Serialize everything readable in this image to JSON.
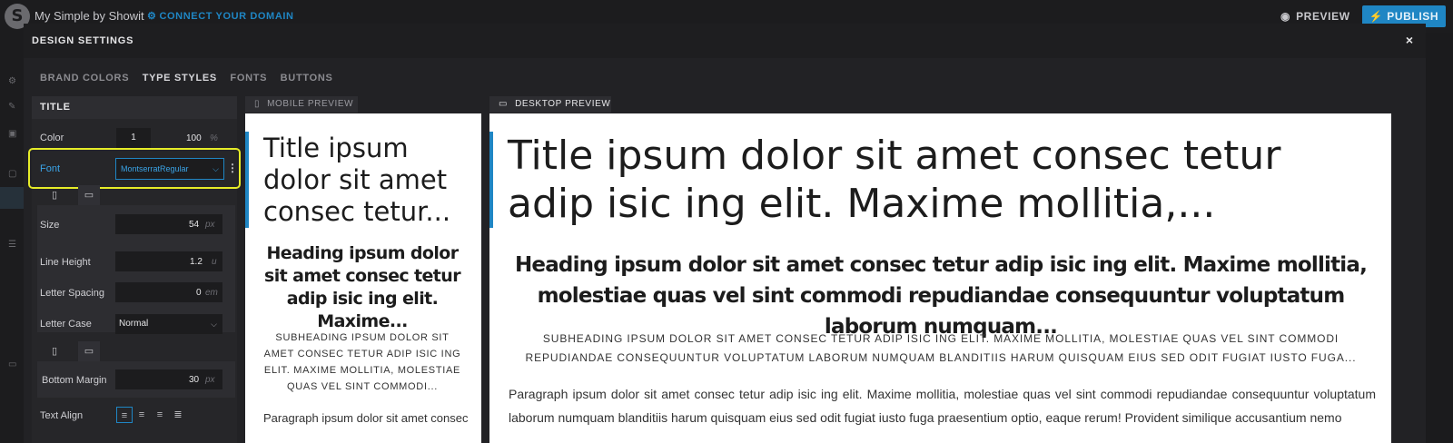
{
  "app": {
    "logo_glyph": "S",
    "site_name": "My Simple by Showit",
    "connect_domain": "CONNECT YOUR DOMAIN",
    "preview_label": "PREVIEW",
    "publish_label": "PUBLISH",
    "accent_color": "#1f86c4",
    "highlight_color": "#e6ec28"
  },
  "modal": {
    "title": "DESIGN SETTINGS",
    "close_glyph": "×",
    "tabs": [
      {
        "label": "BRAND COLORS",
        "active": false
      },
      {
        "label": "TYPE STYLES",
        "active": true
      },
      {
        "label": "FONTS",
        "active": false
      },
      {
        "label": "BUTTONS",
        "active": false
      }
    ]
  },
  "settings": {
    "section_title": "TITLE",
    "color": {
      "label": "Color",
      "swatch_value": "1",
      "opacity": "100",
      "unit": "%"
    },
    "font": {
      "label": "Font",
      "value": "MontserratRegular"
    },
    "size": {
      "label": "Size",
      "value": "54",
      "unit": "px"
    },
    "line_height": {
      "label": "Line Height",
      "value": "1.2",
      "unit": "u"
    },
    "letter_spacing": {
      "label": "Letter Spacing",
      "value": "0",
      "unit": "em"
    },
    "letter_case": {
      "label": "Letter Case",
      "value": "Normal"
    },
    "bottom_margin": {
      "label": "Bottom Margin",
      "value": "30",
      "unit": "px"
    },
    "text_align": {
      "label": "Text Align"
    }
  },
  "mobile_preview": {
    "label": "MOBILE PREVIEW",
    "title": "Title ipsum dolor sit amet consec tetur...",
    "heading": "Heading ipsum dolor sit amet consec tetur adip isic ing elit. Maxime...",
    "subheading": "SUBHEADING IPSUM DOLOR SIT AMET CONSEC TETUR ADIP ISIC ING ELIT. MAXIME MOLLITIA, MOLESTIAE QUAS VEL SINT COMMODI...",
    "paragraph": "Paragraph ipsum dolor sit amet consec"
  },
  "desktop_preview": {
    "label": "DESKTOP PREVIEW",
    "title": "Title ipsum dolor sit amet consec tetur adip isic ing elit. Maxime mollitia,...",
    "heading": "Heading ipsum dolor sit amet consec tetur adip isic ing elit. Maxime mollitia, molestiae quas vel sint commodi repudiandae consequuntur voluptatum laborum numquam...",
    "subheading": "SUBHEADING IPSUM DOLOR SIT AMET CONSEC TETUR ADIP ISIC ING ELIT. MAXIME MOLLITIA, MOLESTIAE QUAS VEL SINT COMMODI REPUDIANDAE CONSEQUUNTUR VOLUPTATUM LABORUM NUMQUAM BLANDITIIS HARUM QUISQUAM EIUS SED ODIT FUGIAT IUSTO FUGA...",
    "paragraph": "Paragraph ipsum dolor sit amet consec tetur adip isic ing elit. Maxime mollitia, molestiae quas vel sint commodi repudiandae consequuntur voluptatum laborum numquam blanditiis harum quisquam eius sed odit fugiat iusto fuga praesentium optio, eaque rerum! Provident similique accusantium nemo"
  },
  "icons": {
    "gear": "⚙",
    "eye": "◉",
    "bolt": "⚡",
    "phone": "▯",
    "monitor": "▭",
    "chevron": "⌵",
    "kebab": "⋮",
    "align_left": "≡",
    "align_center": "≡",
    "align_right": "≡",
    "align_justify": "≣",
    "rail_icons": [
      "⚙",
      "✎",
      "▣",
      "▢",
      "☰",
      "▭"
    ]
  }
}
